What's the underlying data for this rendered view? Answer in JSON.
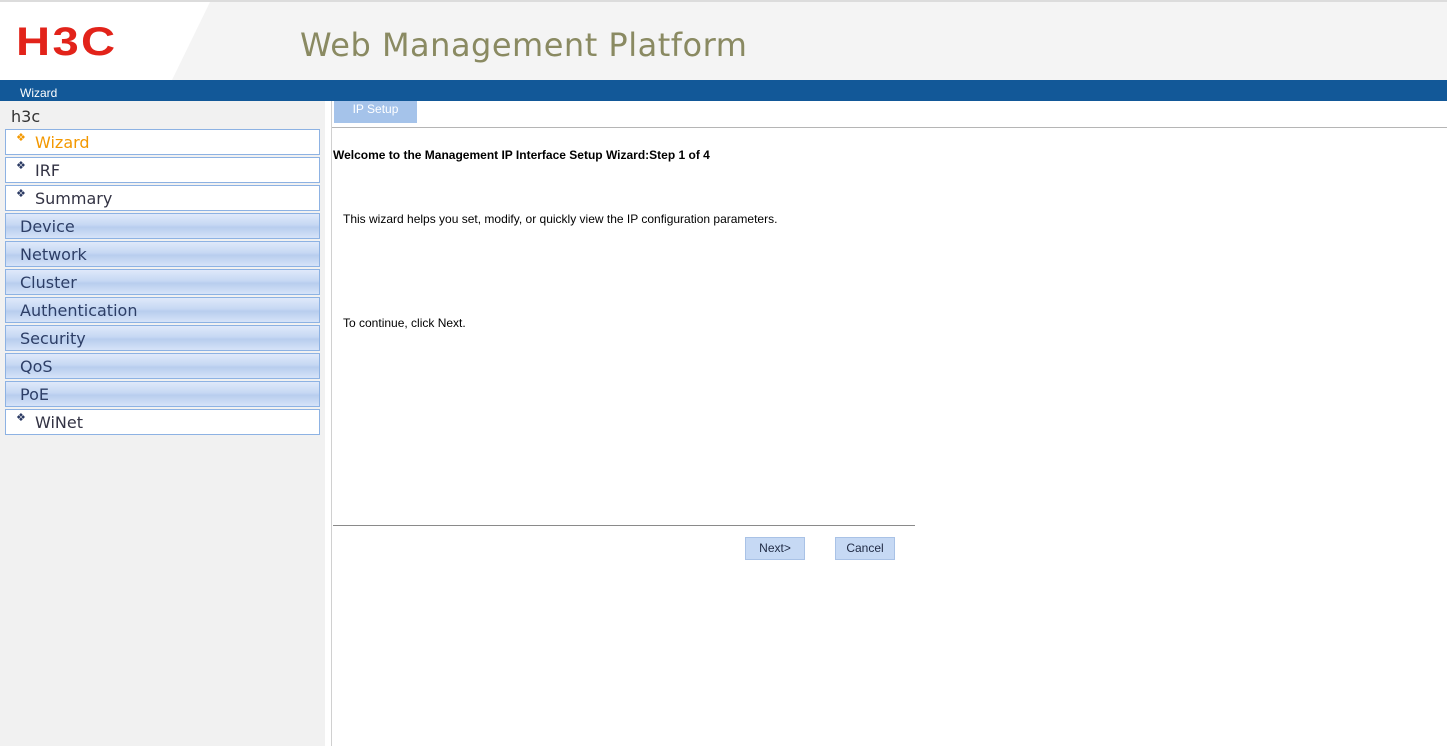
{
  "header": {
    "logo_text": "H3C",
    "platform_title": "Web Management Platform",
    "brand_color": "#e2231a",
    "nav_bar_color": "#125898",
    "nav_items": [
      "Wizard"
    ]
  },
  "sidebar": {
    "device_name": "h3c",
    "items": [
      {
        "label": "Wizard",
        "type": "leaf",
        "active": true
      },
      {
        "label": "IRF",
        "type": "leaf"
      },
      {
        "label": "Summary",
        "type": "leaf"
      },
      {
        "label": "Device",
        "type": "group"
      },
      {
        "label": "Network",
        "type": "group"
      },
      {
        "label": "Cluster",
        "type": "group"
      },
      {
        "label": "Authentication",
        "type": "group"
      },
      {
        "label": "Security",
        "type": "group"
      },
      {
        "label": "QoS",
        "type": "group"
      },
      {
        "label": "PoE",
        "type": "group"
      },
      {
        "label": "WiNet",
        "type": "leaf"
      }
    ],
    "bullet_icon": "diamond-bullet-icon"
  },
  "content": {
    "tab_label": "IP Setup",
    "heading": "Welcome to the Management IP Interface Setup Wizard:Step 1 of 4",
    "intro": "This wizard helps you set, modify, or quickly view the IP configuration parameters.",
    "continue": "To continue, click Next.",
    "buttons": {
      "next": "Next>",
      "cancel": "Cancel"
    }
  }
}
